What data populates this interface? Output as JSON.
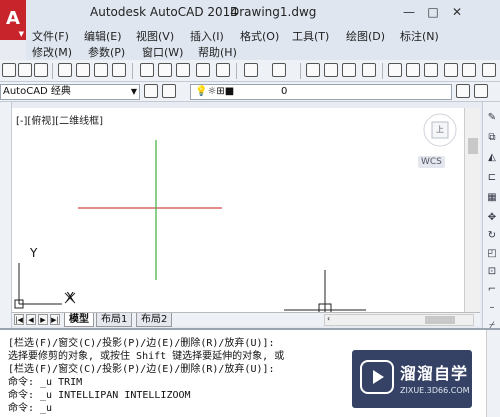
{
  "window": {
    "app_button_label": "A",
    "title": "Autodesk AutoCAD 2014",
    "drawing_name": "Drawing1.dwg",
    "min_glyph": "—",
    "restore_glyph": "□",
    "close_glyph": "✕"
  },
  "menu": {
    "row1": [
      "文件(F)",
      "编辑(E)",
      "视图(V)",
      "插入(I)",
      "格式(O)",
      "工具(T)",
      "绘图(D)",
      "标注(N)"
    ],
    "row2": [
      "修改(M)",
      "参数(P)",
      "窗口(W)",
      "帮助(H)"
    ]
  },
  "toolbar2": {
    "workspace": "AutoCAD 经典",
    "layer_value": "0"
  },
  "canvas": {
    "view_label": "[-][俯视][二维线框]",
    "ucs_y_label": "Y",
    "ucs_x_label": "X",
    "wcs_label": "WCS",
    "viewcube_face": "上"
  },
  "tabs": {
    "items": [
      "模型",
      "布局1",
      "布局2"
    ],
    "active_index": 0
  },
  "command": {
    "lines": [
      "[栏选(F)/窗交(C)/投影(P)/边(E)/删除(R)/放弃(U)]:",
      "选择要修剪的对象, 或按住 Shift 键选择要延伸的对象, 或",
      "[栏选(F)/窗交(C)/投影(P)/边(E)/删除(R)/放弃(U)]:",
      "命令: _u TRIM",
      "命令: _u INTELLIPAN INTELLIZOOM",
      "命令: _u"
    ]
  },
  "watermark": {
    "name": "溜溜自学",
    "url": "ZIXUE.3D66.COM"
  },
  "colors": {
    "crosshair_x": "#d14848",
    "crosshair_y": "#4ab54a",
    "app_red": "#c8242b"
  }
}
